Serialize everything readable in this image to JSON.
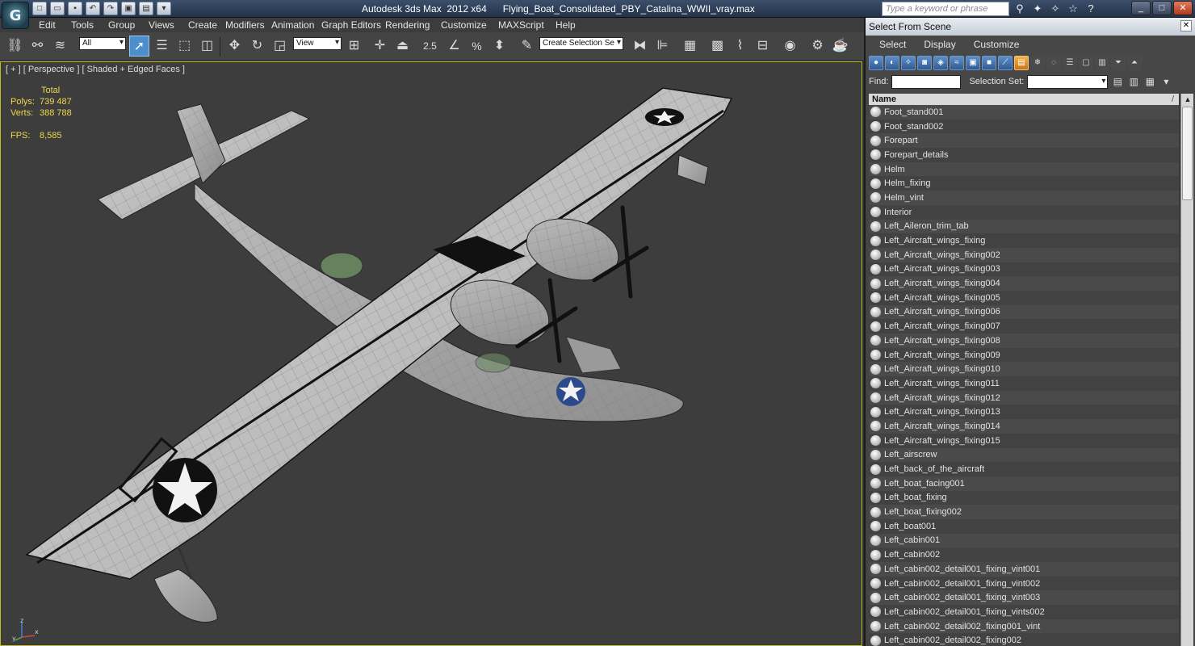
{
  "app": {
    "window_title": "Autodesk 3ds Max  2012 x64      Flying_Boat_Consolidated_PBY_Catalina_WWII_vray.max",
    "logo_glyph": "G",
    "search_placeholder": "Type a keyword or phrase"
  },
  "menu": [
    "Edit",
    "Tools",
    "Group",
    "Views",
    "Create",
    "Modifiers",
    "Animation",
    "Graph Editors",
    "Rendering",
    "Customize",
    "MAXScript",
    "Help"
  ],
  "toolbar": {
    "selection_filter": "All",
    "reference_coord": "View",
    "named_selection_placeholder": "Create Selection Se",
    "snap_value": "2.5",
    "percent_label": "%"
  },
  "viewport": {
    "label": "[ + ] [ Perspective ] [ Shaded + Edged Faces ]",
    "stats": {
      "total_label": "Total",
      "polys_label": "Polys:",
      "polys_value": "739 487",
      "verts_label": "Verts:",
      "verts_value": "388 788",
      "fps_label": "FPS:",
      "fps_value": "8,585"
    },
    "axis_labels": {
      "x": "x",
      "y": "y",
      "z": "z"
    }
  },
  "select_from_scene": {
    "title": "Select From Scene",
    "close_glyph": "✕",
    "menu": [
      "Select",
      "Display",
      "Customize"
    ],
    "find_label": "Find:",
    "find_value": "",
    "selection_set_label": "Selection Set:",
    "column_name": "Name",
    "objects": [
      "Foot_stand001",
      "Foot_stand002",
      "Forepart",
      "Forepart_details",
      "Helm",
      "Helm_fixing",
      "Helm_vint",
      "Interior",
      "Left_Aileron_trim_tab",
      "Left_Aircraft_wings_fixing",
      "Left_Aircraft_wings_fixing002",
      "Left_Aircraft_wings_fixing003",
      "Left_Aircraft_wings_fixing004",
      "Left_Aircraft_wings_fixing005",
      "Left_Aircraft_wings_fixing006",
      "Left_Aircraft_wings_fixing007",
      "Left_Aircraft_wings_fixing008",
      "Left_Aircraft_wings_fixing009",
      "Left_Aircraft_wings_fixing010",
      "Left_Aircraft_wings_fixing011",
      "Left_Aircraft_wings_fixing012",
      "Left_Aircraft_wings_fixing013",
      "Left_Aircraft_wings_fixing014",
      "Left_Aircraft_wings_fixing015",
      "Left_airscrew",
      "Left_back_of_the_aircraft",
      "Left_boat_facing001",
      "Left_boat_fixing",
      "Left_boat_fixing002",
      "Left_boat001",
      "Left_cabin001",
      "Left_cabin002",
      "Left_cabin002_detail001_fixing_vint001",
      "Left_cabin002_detail001_fixing_vint002",
      "Left_cabin002_detail001_fixing_vint003",
      "Left_cabin002_detail001_fixing_vints002",
      "Left_cabin002_detail002_fixing001_vint",
      "Left_cabin002_detail002_fixing002"
    ]
  },
  "colors": {
    "viewport_bg": "#3d3d3d",
    "active_viewport_border": "#bdbd2a",
    "stats_text": "#f0d84a",
    "toolbar_active": "#4d8fcc"
  }
}
